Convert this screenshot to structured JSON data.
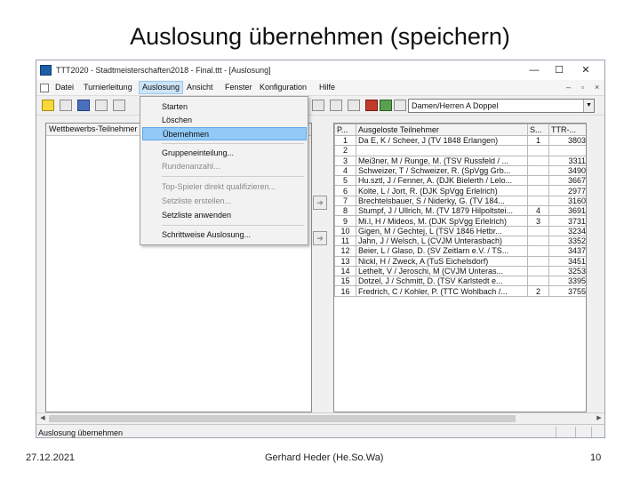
{
  "slide": {
    "title": "Auslosung übernehmen (speichern)",
    "footer_date": "27.12.2021",
    "footer_author": "Gerhard Heder (He.So.Wa)",
    "page_number": "10"
  },
  "window": {
    "title": "TTT2020 - Stadtmeisterschaften2018 - Final.ttt - [Auslosung]",
    "minimize_glyph": "—",
    "maximize_glyph": "☐",
    "close_glyph": "✕"
  },
  "menubar": {
    "items": [
      "Datei",
      "Turnierleitung",
      "Auslosung",
      "Ansicht",
      "Fenster",
      "Konfiguration",
      "Hilfe"
    ],
    "active_index": 2,
    "mdi_minimize": "–",
    "mdi_restore": "▫",
    "mdi_close": "×"
  },
  "toolbar": {
    "combo_value": "Damen/Herren A Doppel",
    "combo_arrow": "▼"
  },
  "auslosung_menu": {
    "items": [
      {
        "label": "Starten",
        "disabled": false
      },
      {
        "label": "Löschen",
        "disabled": false
      },
      {
        "label": "Übernehmen",
        "disabled": false,
        "highlighted": true
      },
      {
        "label": "Gruppeneinteilung...",
        "disabled": false
      },
      {
        "label": "Rundenanzahl...",
        "disabled": true
      },
      {
        "label": "Top-Spieler direkt qualifizieren...",
        "disabled": true
      },
      {
        "label": "Setzliste erstellen...",
        "disabled": true
      },
      {
        "label": "Setzliste anwenden",
        "disabled": false
      },
      {
        "label": "Schrittweise Auslosung...",
        "disabled": false
      }
    ]
  },
  "left_pane": {
    "header": "Wettbewerbs-Teilnehmer",
    "move_right_glyph": "➔",
    "move_left_glyph": "➔"
  },
  "right_table": {
    "columns": [
      "P...",
      "Ausgeloste Teilnehmer",
      "S...",
      "TTR-..."
    ],
    "rows": [
      [
        "1",
        "Da E, K / Scheer, J (TV 1848 Erlangen)",
        "1",
        "3803"
      ],
      [
        "2",
        "",
        "",
        ""
      ],
      [
        "3",
        "Mei3ner, M / Runge, M. (TSV Russfeld / ...",
        "",
        "3311"
      ],
      [
        "4",
        "Schweizer, T / Schweizer, R. (SpVgg Grb...",
        "",
        "3490"
      ],
      [
        "5",
        "Hu.sztl, J / Fenner, A. (DJK Bielerth / Lelo...",
        "",
        "3667"
      ],
      [
        "6",
        "Kolte, L / Jort, R. (DJK SpVgg Erlelrich)",
        "",
        "2977"
      ],
      [
        "7",
        "Brechtelsbauer, S / Niderky, G. (TV 184...",
        "",
        "3160"
      ],
      [
        "8",
        "Stumpf, J / Ullrich, M. (TV 1879 Hilpoltstei...",
        "4",
        "3691"
      ],
      [
        "9",
        "Mi.l, H / Mideos, M. (DJK SpVgg Erlelrich)",
        "3",
        "3731"
      ],
      [
        "10",
        "Gigen, M / Gechtej, L (TSV 1846 Hetbr...",
        "",
        "3234"
      ],
      [
        "11",
        "Jahn, J / Welsch, L (CVJM Unterasbach)",
        "",
        "3352"
      ],
      [
        "12",
        "Beier, L / Glaso, D. (SV Zeitlarn e.V. / TS...",
        "",
        "3437"
      ],
      [
        "13",
        "Nickl, H / Zweck, A (TuS Eichelsdorf)",
        "",
        "3451"
      ],
      [
        "14",
        "Lethelt, V / Jeroschi, M (CVJM Unteras...",
        "",
        "3253"
      ],
      [
        "15",
        "Dotzel, J / Schmitt, D. (TSV Karlstedt e...",
        "",
        "3395"
      ],
      [
        "16",
        "Fredrich, C / Kohler, P. (TTC Wohlbach /...",
        "2",
        "3755"
      ]
    ]
  },
  "statusbar": {
    "text": "Auslosung übernehmen"
  },
  "colors": {
    "menu_highlight": "#91c9f7",
    "active_menu": "#cce4f7",
    "window_bg": "#f0f0f0"
  },
  "icons": [
    "app-icon",
    "save-icon",
    "print-icon",
    "rules-icon",
    "draw-icon",
    "tools-icon",
    "next-icon",
    "grid-icon",
    "list-icon",
    "star-icon",
    "book-icon",
    "help-icon"
  ]
}
